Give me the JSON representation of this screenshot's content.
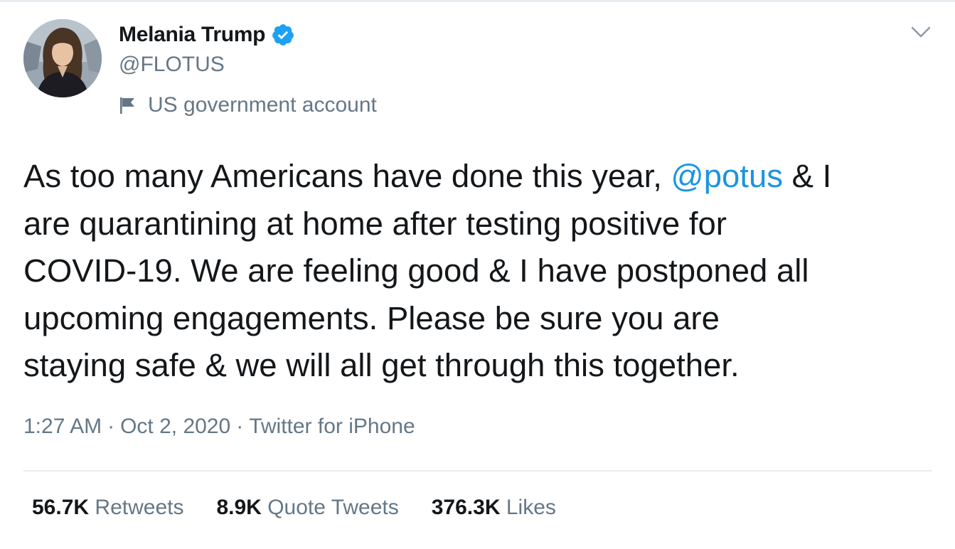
{
  "tweet": {
    "author": {
      "display_name": "Melania Trump",
      "handle": "@FLOTUS",
      "verified": true,
      "account_label": "US government account"
    },
    "text_lines": [
      {
        "before": "As too many Americans have done this year, ",
        "mention": "@potus",
        "after": " & I"
      },
      {
        "text": "are quarantining at home after testing positive for"
      },
      {
        "text": "COVID-19. We are feeling good & I have postponed all"
      },
      {
        "text": "upcoming engagements. Please be sure you are"
      },
      {
        "text": "staying safe & we will all get through this together."
      }
    ],
    "time": "1:27 AM",
    "date": "Oct 2, 2020",
    "source": "Twitter for iPhone",
    "separator": "·",
    "stats": [
      {
        "value": "56.7K",
        "label": "Retweets"
      },
      {
        "value": "8.9K",
        "label": "Quote Tweets"
      },
      {
        "value": "376.3K",
        "label": "Likes"
      }
    ]
  },
  "icons": {
    "avatar": "profile-photo",
    "verified": "verified-badge-icon",
    "flag": "flag-icon",
    "menu": "chevron-down-icon"
  },
  "colors": {
    "mention": "#1b95e0",
    "verified": "#1da1f2",
    "secondary_text": "#657786",
    "primary_text": "#14171a",
    "divider": "#e6ecf0"
  }
}
